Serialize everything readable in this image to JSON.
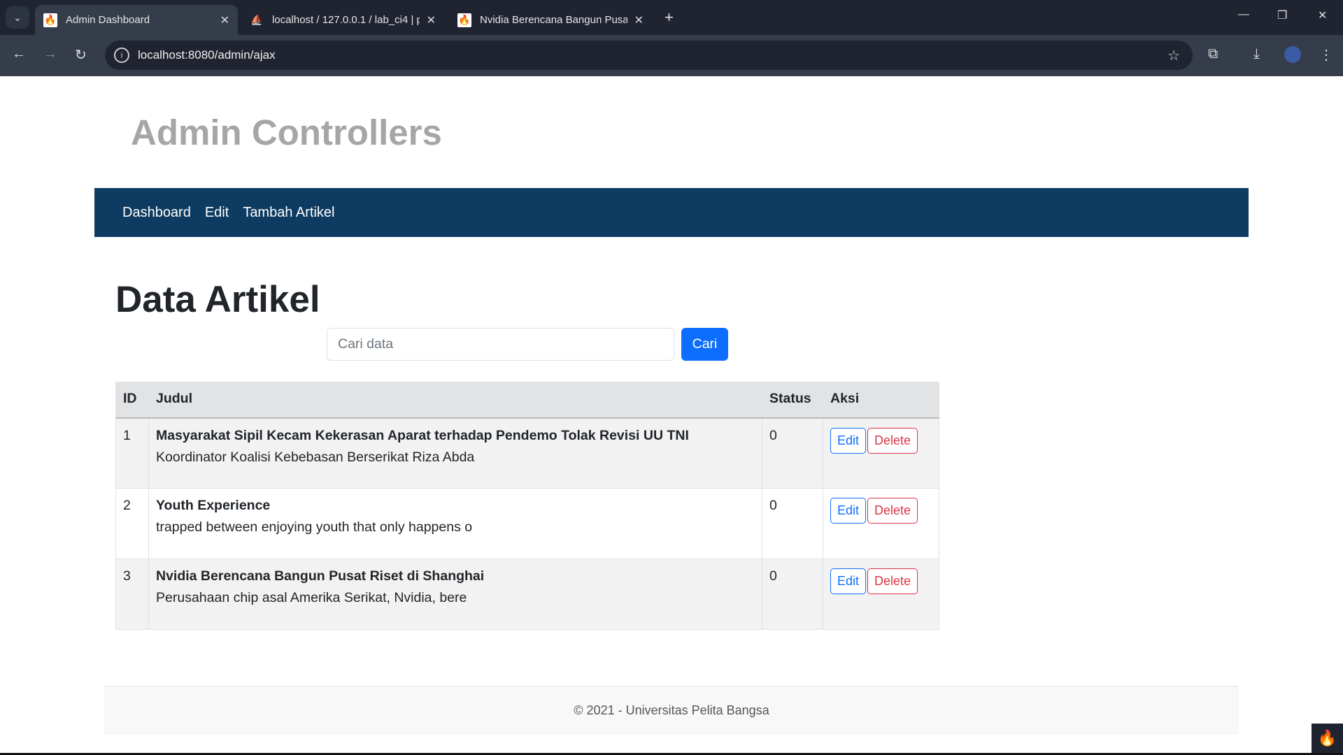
{
  "browser": {
    "tabs": [
      {
        "title": "Admin Dashboard",
        "icon": "codeigniter-flame-icon",
        "active": true
      },
      {
        "title": "localhost / 127.0.0.1 / lab_ci4 | p",
        "icon": "phpmyadmin-icon",
        "active": false
      },
      {
        "title": "Nvidia Berencana Bangun Pusat",
        "icon": "codeigniter-flame-icon",
        "active": false
      }
    ],
    "url": "localhost:8080/admin/ajax"
  },
  "page": {
    "site_title": "Admin Controllers",
    "nav": [
      "Dashboard",
      "Edit",
      "Tambah Artikel"
    ],
    "heading": "Data Artikel",
    "search": {
      "placeholder": "Cari data",
      "value": "",
      "button": "Cari"
    },
    "table": {
      "headers": [
        "ID",
        "Judul",
        "Status",
        "Aksi"
      ],
      "rows": [
        {
          "id": "1",
          "title": "Masyarakat Sipil Kecam Kekerasan Aparat terhadap Pendemo Tolak Revisi UU TNI",
          "excerpt": "Koordinator Koalisi Kebebasan Berserikat Riza Abda",
          "status": "0",
          "edit": "Edit",
          "delete": "Delete"
        },
        {
          "id": "2",
          "title": "Youth Experience",
          "excerpt": "trapped between enjoying youth that only happens o",
          "status": "0",
          "edit": "Edit",
          "delete": "Delete"
        },
        {
          "id": "3",
          "title": "Nvidia Berencana Bangun Pusat Riset di Shanghai",
          "excerpt": "Perusahaan chip asal Amerika Serikat, Nvidia, bere",
          "status": "0",
          "edit": "Edit",
          "delete": "Delete"
        }
      ]
    },
    "footer": "© 2021 - Universitas Pelita Bangsa"
  },
  "colors": {
    "navbar": "#0e3b61",
    "primary": "#0d6efd",
    "danger": "#dc3545"
  }
}
